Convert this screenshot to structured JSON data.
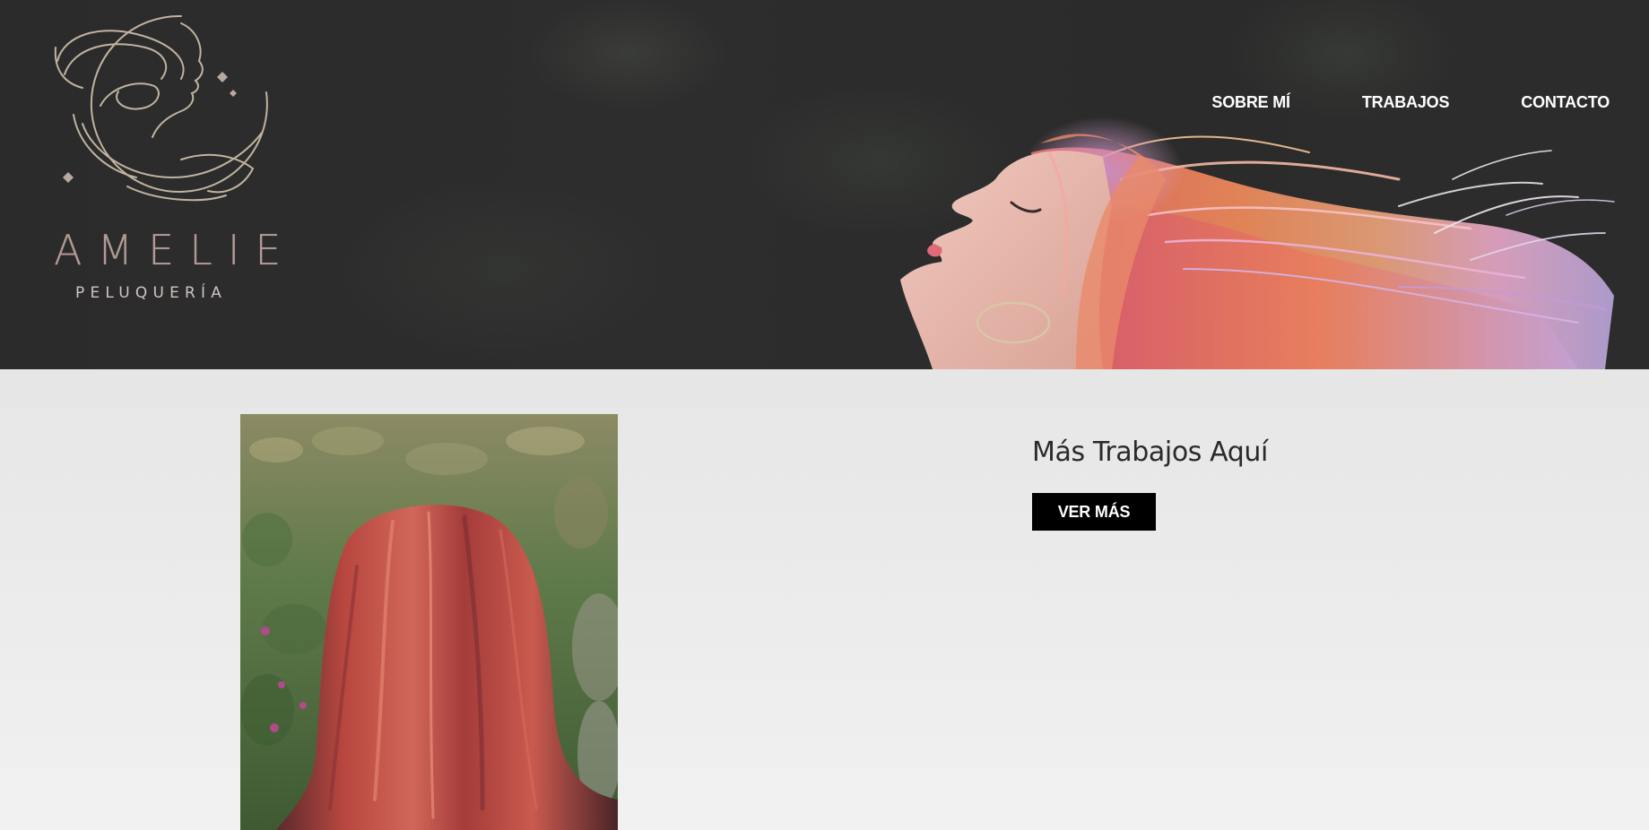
{
  "brand": {
    "name": "AMELIE",
    "tagline": "PELUQUERÍA",
    "logo_icon": "woman-profile-line-art-icon"
  },
  "nav": {
    "items": [
      {
        "label": "SOBRE MÍ"
      },
      {
        "label": "TRABAJOS"
      },
      {
        "label": "CONTACTO"
      }
    ]
  },
  "hero": {
    "image": "woman-with-pastel-rainbow-hair-photo"
  },
  "works": {
    "image": "red-highlighted-hair-back-view-photo",
    "title": "Más Trabajos Aquí",
    "button_label": "VER MÁS"
  },
  "colors": {
    "hero_background": "#2b2b2b",
    "logo_gold": "#b39b94",
    "button_background": "#000000",
    "button_text": "#ffffff",
    "page_background_top": "#d9d9d9",
    "page_background_bottom": "#f1f1f1"
  }
}
